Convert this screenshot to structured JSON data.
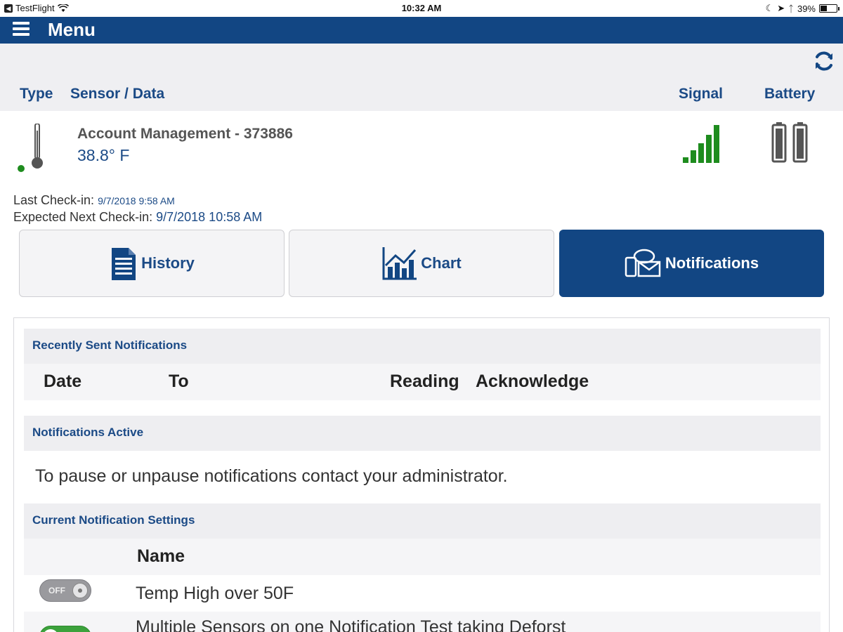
{
  "status_bar": {
    "app": "TestFlight",
    "time": "10:32 AM",
    "battery": "39%",
    "battery_level": 0.39
  },
  "nav": {
    "title": "Menu"
  },
  "table_header": {
    "type": "Type",
    "sensor_data": "Sensor / Data",
    "signal": "Signal",
    "battery": "Battery"
  },
  "sensor": {
    "name": "Account Management - 373886",
    "reading": "38.8° F",
    "signal_bars": 5,
    "battery_icon": "battery-full-icon",
    "status_color": "#1e8c1e"
  },
  "checkin": {
    "last_label": "Last Check-in:",
    "last_value": "9/7/2018 9:58 AM",
    "next_label": "Expected Next Check-in:",
    "next_value": "9/7/2018 10:58 AM"
  },
  "tabs": [
    {
      "label": "History",
      "icon": "document-icon",
      "active": false
    },
    {
      "label": "Chart",
      "icon": "chart-icon",
      "active": false
    },
    {
      "label": "Notifications",
      "icon": "notifications-icon",
      "active": true
    }
  ],
  "recent": {
    "title": "Recently Sent Notifications",
    "columns": [
      "Date",
      "To",
      "Reading",
      "Acknowledge"
    ]
  },
  "active": {
    "title": "Notifications Active",
    "message": "To pause or unpause notifications contact your administrator."
  },
  "settings": {
    "title": "Current Notification Settings",
    "column": "Name",
    "items": [
      {
        "name": "Temp High over 50F",
        "enabled": false,
        "toggle_label": "OFF"
      },
      {
        "name": "Multiple Sensors on one Notification Test taking Deforst",
        "enabled": true,
        "toggle_label": ""
      }
    ]
  },
  "colors": {
    "brand": "#124683",
    "accent_text": "#1b4a86",
    "signal_green": "#1e8c1e",
    "toggle_on": "#3ca23c"
  }
}
